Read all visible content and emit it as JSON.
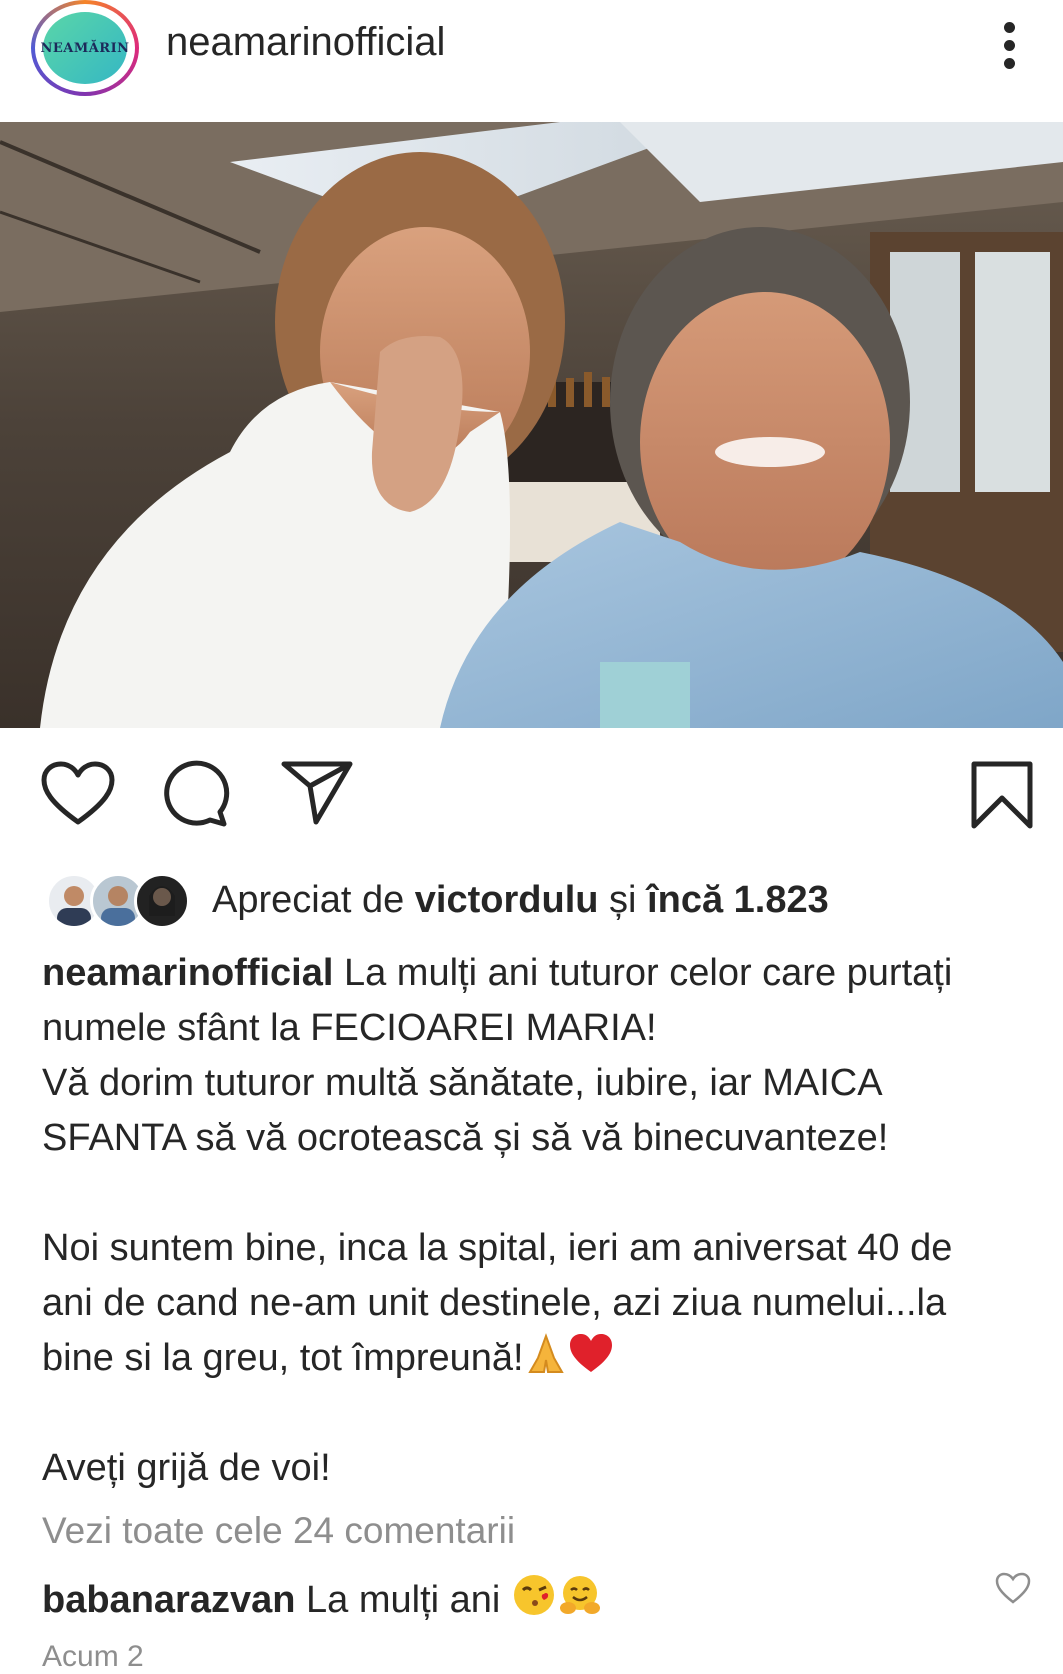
{
  "post": {
    "username": "neamarinofficial",
    "avatar_text": "NEAMĂRIN",
    "more_icon": "more-vertical-icon"
  },
  "likes": {
    "prefix": "Apreciat de ",
    "user": "victordulu",
    "middle": " și ",
    "count": "încă 1.823"
  },
  "caption": {
    "username": "neamarinofficial",
    "line1": " La mulți ani tuturor celor care purtați",
    "line2": "numele sfânt la FECIOAREI MARIA!",
    "line3": "Vă dorim tuturor multă sănătate, iubire, iar MAICA",
    "line4": "SFANTA să vă ocrotească și să vă binecuvanteze!",
    "line5": "Noi suntem bine, inca la spital, ieri am aniversat 40 de",
    "line6": "ani de cand ne-am unit destinele, azi ziua numelui...la",
    "line7": "bine si la greu, tot împreună!",
    "line8": "Aveți grijă de voi!"
  },
  "comments": {
    "view_all": "Vezi toate cele 24 comentarii",
    "first_user": "babanarazvan",
    "first_text": " La mulți ani"
  },
  "time_partial": "Acum 2"
}
